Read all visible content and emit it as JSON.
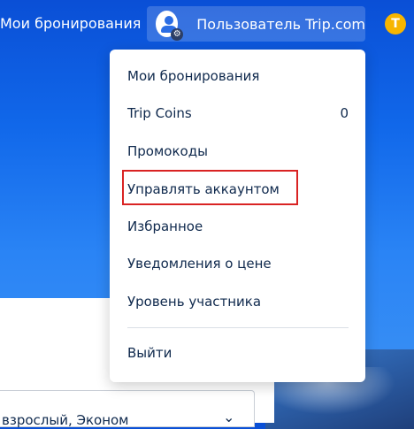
{
  "header": {
    "my_bookings": "Мои бронирования",
    "user_label": "Пользователь Trip.com",
    "coin_letter": "T"
  },
  "menu": {
    "items": [
      {
        "label": "Мои бронирования"
      },
      {
        "label": "Trip Coins",
        "count": "0"
      },
      {
        "label": "Промокоды"
      },
      {
        "label": "Управлять аккаунтом",
        "highlighted": true
      },
      {
        "label": "Избранное"
      },
      {
        "label": "Уведомления о цене"
      },
      {
        "label": "Уровень участника"
      }
    ],
    "logout": "Выйти"
  },
  "search": {
    "passengers_value": "взрослый, Эконом"
  },
  "colors": {
    "brand_blue": "#1168ea",
    "highlight_red": "#d92323",
    "coin": "#f7b500",
    "text_dark": "#0f294d"
  }
}
